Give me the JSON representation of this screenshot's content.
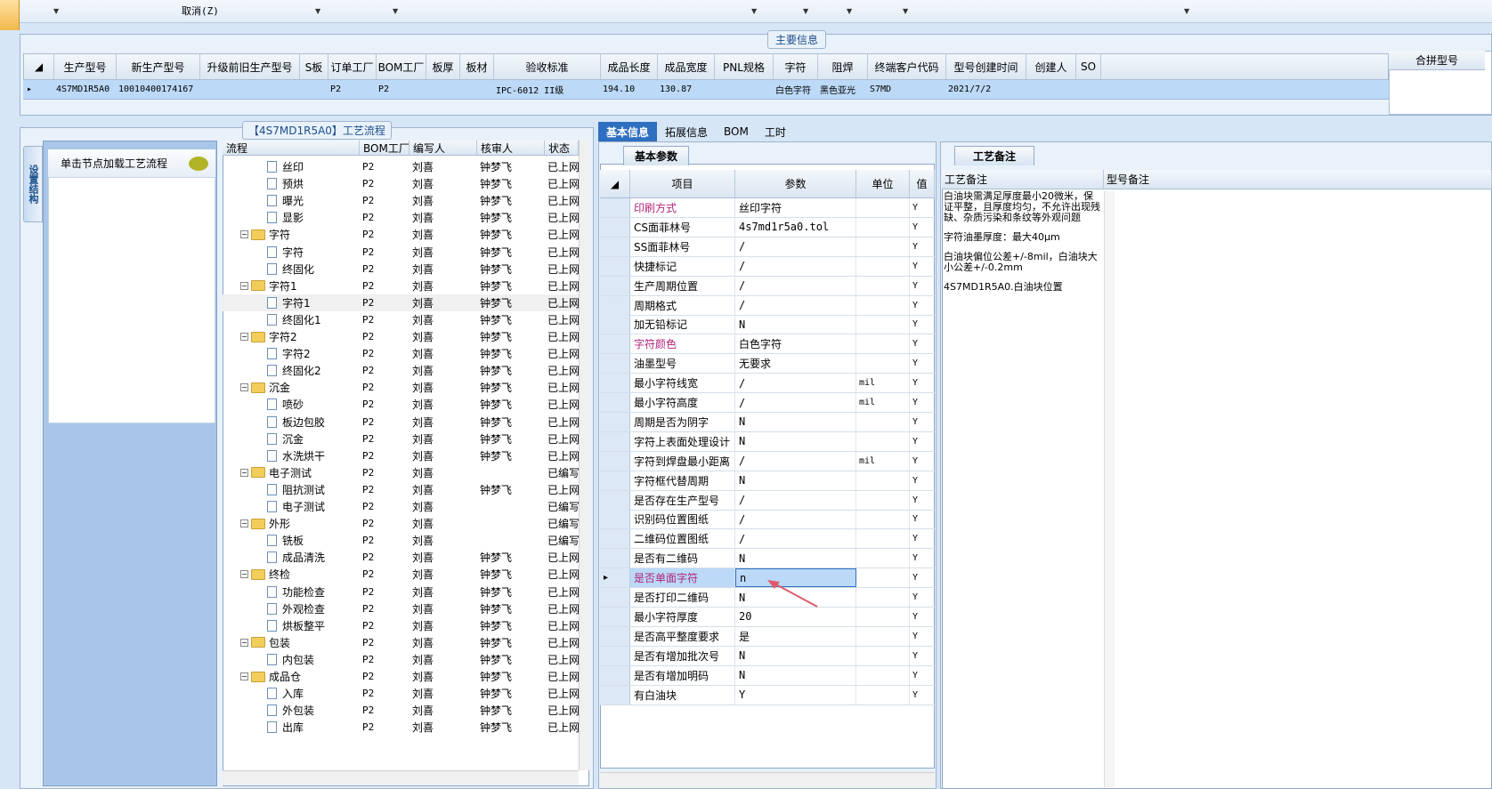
{
  "toolbar": {
    "cancel_label": "取消(Z)"
  },
  "main_info": {
    "title": "主要信息",
    "columns": [
      "生产型号",
      "新生产型号",
      "升级前旧生产型号",
      "S板",
      "订单工厂",
      "BOM工厂",
      "板厚",
      "板材",
      "验收标准",
      "成品长度",
      "成品宽度",
      "PNL规格",
      "字符",
      "阻焊",
      "终端客户代码",
      "型号创建时间",
      "创建人",
      "SO"
    ],
    "row": [
      "4S7MD1R5A0",
      "10010400174167",
      "",
      "",
      "P2",
      "P2",
      "",
      "",
      "IPC-6012 II级",
      "194.10",
      "130.87",
      "",
      "白色字符",
      "黑色亚光",
      "S7MD",
      "2021/7/2",
      "",
      ""
    ],
    "merge_header": "合拼型号"
  },
  "workflow": {
    "title": "【4S7MD1R5A0】工艺流程",
    "vertical_tab": "设置结构",
    "node_tip": "单击节点加载工艺流程",
    "columns": [
      "流程",
      "BOM工厂",
      "编写人",
      "核审人",
      "状态"
    ],
    "rows": [
      {
        "name": "丝印",
        "level": 2,
        "type": "doc",
        "bom": "P2",
        "writer": "刘喜",
        "reviewer": "钟梦飞",
        "status": "已上网"
      },
      {
        "name": "预烘",
        "level": 2,
        "type": "doc",
        "bom": "P2",
        "writer": "刘喜",
        "reviewer": "钟梦飞",
        "status": "已上网"
      },
      {
        "name": "曝光",
        "level": 2,
        "type": "doc",
        "bom": "P2",
        "writer": "刘喜",
        "reviewer": "钟梦飞",
        "status": "已上网"
      },
      {
        "name": "显影",
        "level": 2,
        "type": "doc",
        "bom": "P2",
        "writer": "刘喜",
        "reviewer": "钟梦飞",
        "status": "已上网"
      },
      {
        "name": "字符",
        "level": 1,
        "type": "folder",
        "bom": "P2",
        "writer": "刘喜",
        "reviewer": "钟梦飞",
        "status": "已上网"
      },
      {
        "name": "字符",
        "level": 2,
        "type": "doc",
        "bom": "P2",
        "writer": "刘喜",
        "reviewer": "钟梦飞",
        "status": "已上网"
      },
      {
        "name": "终固化",
        "level": 2,
        "type": "doc",
        "bom": "P2",
        "writer": "刘喜",
        "reviewer": "钟梦飞",
        "status": "已上网"
      },
      {
        "name": "字符1",
        "level": 1,
        "type": "folder",
        "bom": "P2",
        "writer": "刘喜",
        "reviewer": "钟梦飞",
        "status": "已上网"
      },
      {
        "name": "字符1",
        "level": 2,
        "type": "doc",
        "bom": "P2",
        "writer": "刘喜",
        "reviewer": "钟梦飞",
        "status": "已上网",
        "selected": true
      },
      {
        "name": "终固化1",
        "level": 2,
        "type": "doc",
        "bom": "P2",
        "writer": "刘喜",
        "reviewer": "钟梦飞",
        "status": "已上网"
      },
      {
        "name": "字符2",
        "level": 1,
        "type": "folder",
        "bom": "P2",
        "writer": "刘喜",
        "reviewer": "钟梦飞",
        "status": "已上网"
      },
      {
        "name": "字符2",
        "level": 2,
        "type": "doc",
        "bom": "P2",
        "writer": "刘喜",
        "reviewer": "钟梦飞",
        "status": "已上网"
      },
      {
        "name": "终固化2",
        "level": 2,
        "type": "doc",
        "bom": "P2",
        "writer": "刘喜",
        "reviewer": "钟梦飞",
        "status": "已上网"
      },
      {
        "name": "沉金",
        "level": 1,
        "type": "folder",
        "bom": "P2",
        "writer": "刘喜",
        "reviewer": "钟梦飞",
        "status": "已上网"
      },
      {
        "name": "喷砂",
        "level": 2,
        "type": "doc",
        "bom": "P2",
        "writer": "刘喜",
        "reviewer": "钟梦飞",
        "status": "已上网"
      },
      {
        "name": "板边包胶",
        "level": 2,
        "type": "doc",
        "bom": "P2",
        "writer": "刘喜",
        "reviewer": "钟梦飞",
        "status": "已上网"
      },
      {
        "name": "沉金",
        "level": 2,
        "type": "doc",
        "bom": "P2",
        "writer": "刘喜",
        "reviewer": "钟梦飞",
        "status": "已上网"
      },
      {
        "name": "水洗烘干",
        "level": 2,
        "type": "doc",
        "bom": "P2",
        "writer": "刘喜",
        "reviewer": "钟梦飞",
        "status": "已上网"
      },
      {
        "name": "电子测试",
        "level": 1,
        "type": "folder",
        "bom": "P2",
        "writer": "刘喜",
        "reviewer": "",
        "status": "已编写"
      },
      {
        "name": "阻抗测试",
        "level": 2,
        "type": "doc",
        "bom": "P2",
        "writer": "刘喜",
        "reviewer": "钟梦飞",
        "status": "已上网"
      },
      {
        "name": "电子测试",
        "level": 2,
        "type": "doc",
        "bom": "P2",
        "writer": "刘喜",
        "reviewer": "",
        "status": "已编写"
      },
      {
        "name": "外形",
        "level": 1,
        "type": "folder",
        "bom": "P2",
        "writer": "刘喜",
        "reviewer": "",
        "status": "已编写"
      },
      {
        "name": "铣板",
        "level": 2,
        "type": "doc",
        "bom": "P2",
        "writer": "刘喜",
        "reviewer": "",
        "status": "已编写"
      },
      {
        "name": "成品清洗",
        "level": 2,
        "type": "doc",
        "bom": "P2",
        "writer": "刘喜",
        "reviewer": "钟梦飞",
        "status": "已上网"
      },
      {
        "name": "终检",
        "level": 1,
        "type": "folder",
        "bom": "P2",
        "writer": "刘喜",
        "reviewer": "钟梦飞",
        "status": "已上网"
      },
      {
        "name": "功能检查",
        "level": 2,
        "type": "doc",
        "bom": "P2",
        "writer": "刘喜",
        "reviewer": "钟梦飞",
        "status": "已上网"
      },
      {
        "name": "外观检查",
        "level": 2,
        "type": "doc",
        "bom": "P2",
        "writer": "刘喜",
        "reviewer": "钟梦飞",
        "status": "已上网"
      },
      {
        "name": "烘板整平",
        "level": 2,
        "type": "doc",
        "bom": "P2",
        "writer": "刘喜",
        "reviewer": "钟梦飞",
        "status": "已上网"
      },
      {
        "name": "包装",
        "level": 1,
        "type": "folder",
        "bom": "P2",
        "writer": "刘喜",
        "reviewer": "钟梦飞",
        "status": "已上网"
      },
      {
        "name": "内包装",
        "level": 2,
        "type": "doc",
        "bom": "P2",
        "writer": "刘喜",
        "reviewer": "钟梦飞",
        "status": "已上网"
      },
      {
        "name": "成品仓",
        "level": 1,
        "type": "folder",
        "bom": "P2",
        "writer": "刘喜",
        "reviewer": "钟梦飞",
        "status": "已上网"
      },
      {
        "name": "入库",
        "level": 2,
        "type": "doc",
        "bom": "P2",
        "writer": "刘喜",
        "reviewer": "钟梦飞",
        "status": "已上网"
      },
      {
        "name": "外包装",
        "level": 2,
        "type": "doc",
        "bom": "P2",
        "writer": "刘喜",
        "reviewer": "钟梦飞",
        "status": "已上网"
      },
      {
        "name": "出库",
        "level": 2,
        "type": "doc",
        "bom": "P2",
        "writer": "刘喜",
        "reviewer": "钟梦飞",
        "status": "已上网"
      }
    ]
  },
  "mid_tabs": [
    "基本信息",
    "拓展信息",
    "BOM",
    "工时"
  ],
  "basic_params": {
    "tab_label": "基本参数",
    "columns": [
      "项目",
      "参数",
      "单位",
      "值"
    ],
    "rows": [
      {
        "item": "印刷方式",
        "value": "丝印字符",
        "unit": "",
        "flag": "Y",
        "pink": true
      },
      {
        "item": "CS面菲林号",
        "value": "4s7md1r5a0.tol",
        "unit": "",
        "flag": "Y",
        "mono": true
      },
      {
        "item": "SS面菲林号",
        "value": "/",
        "unit": "",
        "flag": "Y"
      },
      {
        "item": "快捷标记",
        "value": "/",
        "unit": "",
        "flag": "Y"
      },
      {
        "item": "生产周期位置",
        "value": "/",
        "unit": "",
        "flag": "Y"
      },
      {
        "item": "周期格式",
        "value": "/",
        "unit": "",
        "flag": "Y"
      },
      {
        "item": "加无铅标记",
        "value": "N",
        "unit": "",
        "flag": "Y"
      },
      {
        "item": "字符颜色",
        "value": "白色字符",
        "unit": "",
        "flag": "Y",
        "pink": true
      },
      {
        "item": "油墨型号",
        "value": "无要求",
        "unit": "",
        "flag": "Y"
      },
      {
        "item": "最小字符线宽",
        "value": "/",
        "unit": "mil",
        "flag": "Y"
      },
      {
        "item": "最小字符高度",
        "value": "/",
        "unit": "mil",
        "flag": "Y"
      },
      {
        "item": "周期是否为阴字",
        "value": "N",
        "unit": "",
        "flag": "Y"
      },
      {
        "item": "字符上表面处理设计",
        "value": "N",
        "unit": "",
        "flag": "Y"
      },
      {
        "item": "字符到焊盘最小距离",
        "value": "/",
        "unit": "mil",
        "flag": "Y"
      },
      {
        "item": "字符框代替周期",
        "value": "N",
        "unit": "",
        "flag": "Y"
      },
      {
        "item": "是否存在生产型号",
        "value": "/",
        "unit": "",
        "flag": "Y"
      },
      {
        "item": "识别码位置图纸",
        "value": "/",
        "unit": "",
        "flag": "Y"
      },
      {
        "item": "二维码位置图纸",
        "value": "/",
        "unit": "",
        "flag": "Y"
      },
      {
        "item": "是否有二维码",
        "value": "N",
        "unit": "",
        "flag": "Y"
      },
      {
        "item": "是否单面字符",
        "value": "n",
        "unit": "",
        "flag": "Y",
        "pink": true,
        "highlight": true
      },
      {
        "item": "是否打印二维码",
        "value": "N",
        "unit": "",
        "flag": "Y"
      },
      {
        "item": "最小字符厚度",
        "value": "20",
        "unit": "",
        "flag": "Y"
      },
      {
        "item": "是否高平整度要求",
        "value": "是",
        "unit": "",
        "flag": "Y"
      },
      {
        "item": "是否有增加批次号",
        "value": "N",
        "unit": "",
        "flag": "Y"
      },
      {
        "item": "是否有增加明码",
        "value": "N",
        "unit": "",
        "flag": "Y"
      },
      {
        "item": "有白油块",
        "value": "Y",
        "unit": "",
        "flag": "Y"
      }
    ]
  },
  "process_notes": {
    "tab_label": "工艺备注",
    "columns": [
      "工艺备注",
      "型号备注"
    ],
    "paragraphs": [
      "白油块需满足厚度最小20微米，保证平整，且厚度均匀，不允许出现残缺、杂质污染和条纹等外观问题",
      "字符油墨厚度：最大40μm",
      "白油块偏位公差+/-8mil，白油块大小公差+/-0.2mm",
      "4S7MD1R5A0.白油块位置"
    ]
  },
  "colors": {
    "accent": "#2f6fbf",
    "selection": "#bcd9f7",
    "pink": "#b0257a",
    "frame": "#d6e6f7"
  }
}
